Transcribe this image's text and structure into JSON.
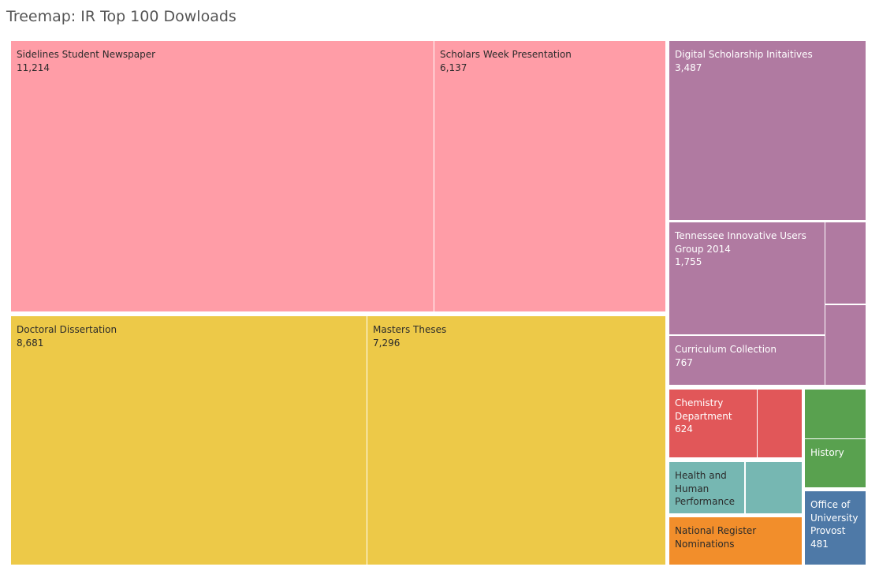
{
  "page": {
    "title": "Treemap: IR Top 100 Dowloads"
  },
  "chart_data": {
    "type": "treemap",
    "title": "Treemap: IR Top 100 Dowloads",
    "colors": {
      "pink": "#FF9DA7",
      "yellow": "#EDC948",
      "purple": "#B07AA1",
      "red": "#E15759",
      "teal": "#76B7B2",
      "orange": "#F28E2B",
      "green": "#59A14F",
      "blue": "#4E79A7"
    },
    "cells": [
      {
        "id": "sidelines",
        "label": "Sidelines Student Newspaper",
        "value": "11,214",
        "color": "pink",
        "text": "dark"
      },
      {
        "id": "scholars",
        "label": "Scholars Week Presentation",
        "value": "6,137",
        "color": "pink",
        "text": "dark"
      },
      {
        "id": "doctoral",
        "label": "Doctoral Dissertation",
        "value": "8,681",
        "color": "yellow",
        "text": "dark"
      },
      {
        "id": "masters",
        "label": "Masters Theses",
        "value": "7,296",
        "color": "yellow",
        "text": "dark"
      },
      {
        "id": "digital",
        "label": "Digital Scholarship Initaitives",
        "value": "3,487",
        "color": "purple",
        "text": "light"
      },
      {
        "id": "tiug",
        "label": "Tennessee Innovative Users Group 2014",
        "value": "1,755",
        "color": "purple",
        "text": "light"
      },
      {
        "id": "purple-small-1",
        "label": "",
        "value": "",
        "color": "purple",
        "text": "light"
      },
      {
        "id": "purple-small-2",
        "label": "",
        "value": "",
        "color": "purple",
        "text": "light"
      },
      {
        "id": "curriculum",
        "label": "Curriculum Collection",
        "value": "767",
        "color": "purple",
        "text": "light"
      },
      {
        "id": "chemistry",
        "label": "Chemistry Department",
        "value": "624",
        "color": "red",
        "text": "light"
      },
      {
        "id": "red-small",
        "label": "",
        "value": "",
        "color": "red",
        "text": "light"
      },
      {
        "id": "health",
        "label": "Health and Human Performance",
        "value": "",
        "color": "teal",
        "text": "dark"
      },
      {
        "id": "teal-small",
        "label": "",
        "value": "",
        "color": "teal",
        "text": "dark"
      },
      {
        "id": "national",
        "label": "National Register Nominations",
        "value": "",
        "color": "orange",
        "text": "dark"
      },
      {
        "id": "green-small",
        "label": "",
        "value": "",
        "color": "green",
        "text": "light"
      },
      {
        "id": "history",
        "label": "History",
        "value": "",
        "color": "green",
        "text": "light"
      },
      {
        "id": "provost",
        "label": "Office of University Provost",
        "value": "481",
        "color": "blue",
        "text": "light"
      }
    ]
  }
}
